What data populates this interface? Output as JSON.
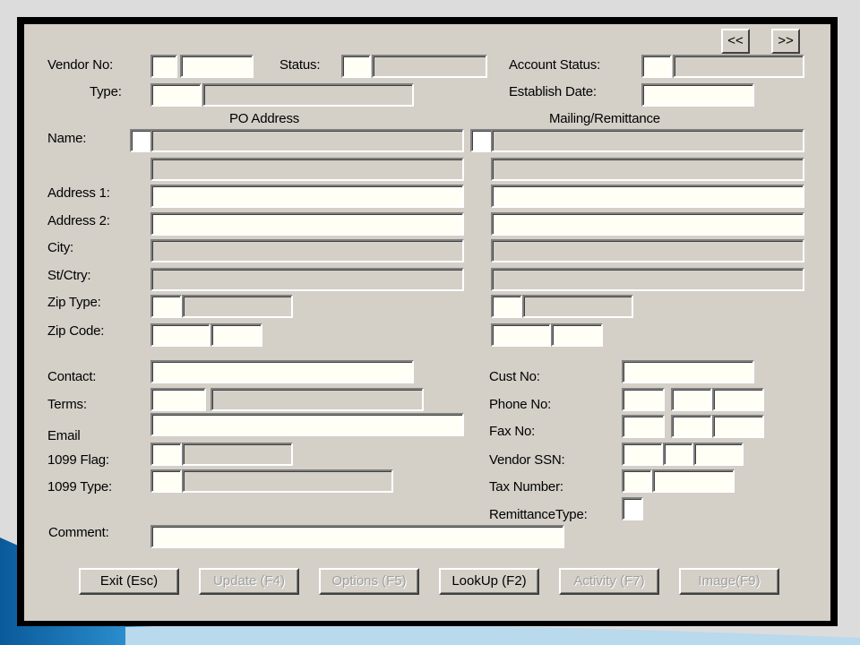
{
  "nav": {
    "prev": "<<",
    "next": ">>"
  },
  "labels": {
    "vendor_no": "Vendor No:",
    "status": "Status:",
    "account_status": "Account Status:",
    "type": "Type:",
    "establish_date": "Establish Date:",
    "po_address": "PO Address",
    "mailing_remittance": "Mailing/Remittance",
    "name": "Name:",
    "address1": "Address 1:",
    "address2": "Address 2:",
    "city": "City:",
    "st_ctry": "St/Ctry:",
    "zip_type": "Zip Type:",
    "zip_code": "Zip Code:",
    "contact": "Contact:",
    "terms": "Terms:",
    "email": "Email",
    "flag_1099": "1099 Flag:",
    "type_1099": "1099 Type:",
    "comment": "Comment:",
    "cust_no": "Cust No:",
    "phone_no": "Phone No:",
    "fax_no": "Fax No:",
    "vendor_ssn": "Vendor SSN:",
    "tax_number": "Tax Number:",
    "remittance_type": "RemittanceType:"
  },
  "buttons": {
    "exit": "Exit (Esc)",
    "update": "Update (F4)",
    "options": "Options (F5)",
    "lookup": "LookUp (F2)",
    "activity": "Activity (F7)",
    "image": "Image(F9)"
  },
  "colors": {
    "panel": "#d4d0c8",
    "frame": "#000000",
    "accent": "#1a8fd8"
  }
}
